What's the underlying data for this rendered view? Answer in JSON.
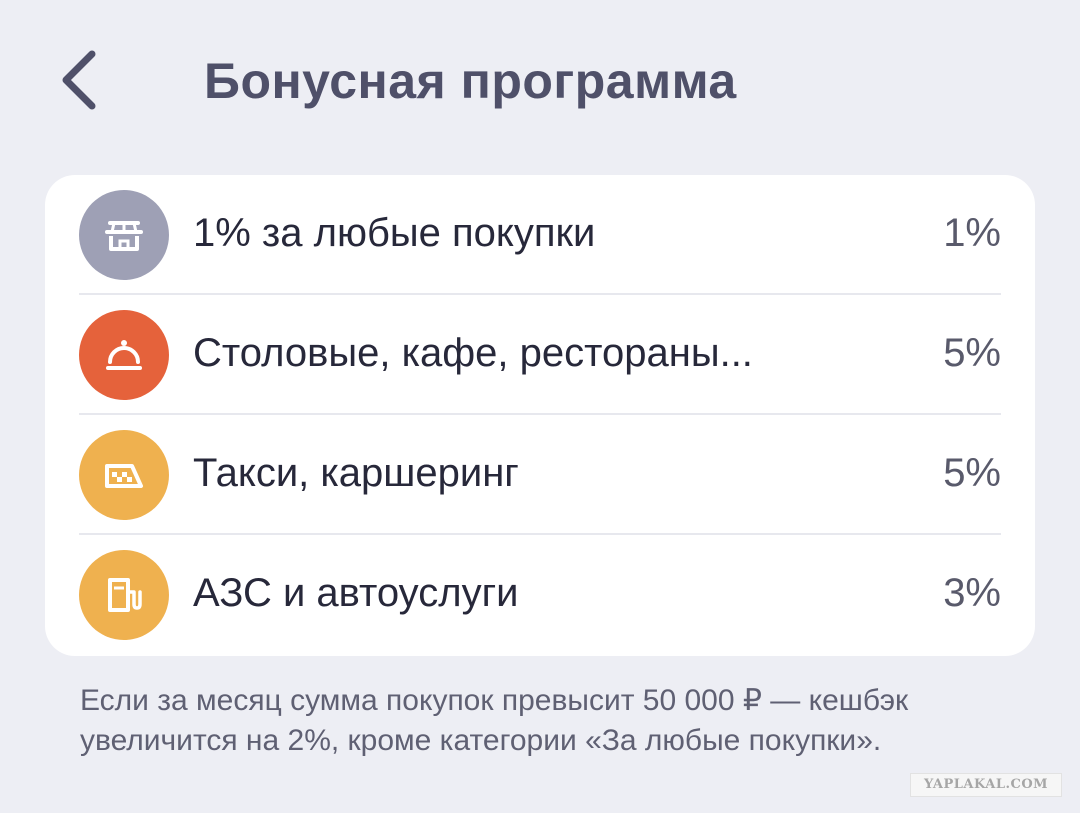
{
  "header": {
    "title": "Бонусная программа",
    "back_icon": "chevron-left-icon"
  },
  "colors": {
    "background": "#edeef4",
    "card": "#ffffff",
    "title": "#4f5069",
    "icon_any_purchases": "#9ea0b5",
    "icon_restaurants": "#e5623b",
    "icon_taxi": "#efb14f",
    "icon_fuel": "#efb14f"
  },
  "categories": [
    {
      "label": "1% за любые покупки",
      "value": "1%",
      "icon": "store-icon"
    },
    {
      "label": "Столовые, кафе, рестораны...",
      "value": "5%",
      "icon": "food-cloche-icon"
    },
    {
      "label": "Такси, каршеринг",
      "value": "5%",
      "icon": "taxi-icon"
    },
    {
      "label": "АЗС и автоуслуги",
      "value": "3%",
      "icon": "fuel-pump-icon"
    }
  ],
  "note": "Если за месяц сумма покупок превысит 50 000 ₽ — кешбэк увеличится на 2%, кроме категории «За любые покупки».",
  "watermark": "YAPLAKAL.COM"
}
